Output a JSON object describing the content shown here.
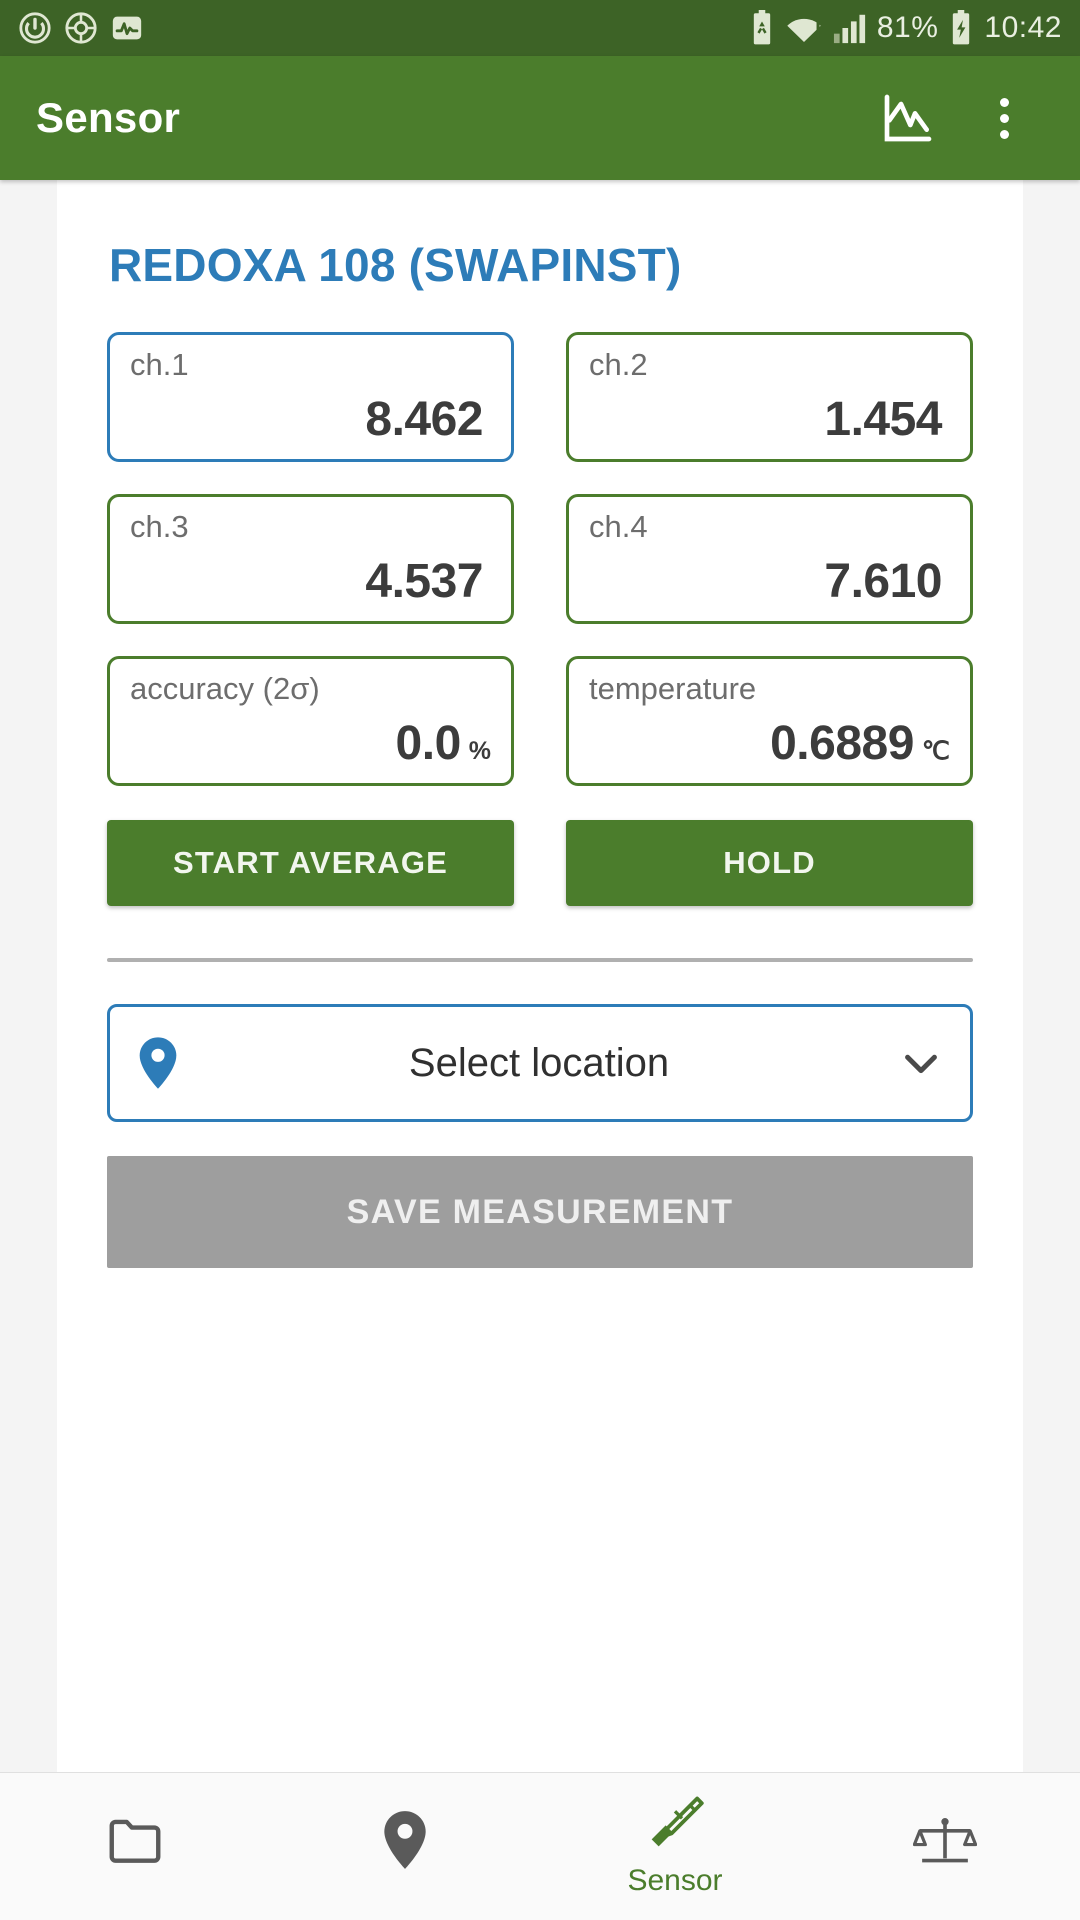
{
  "status_bar": {
    "time": "10:42",
    "battery_percent": "81%",
    "icons_left": [
      "power-circle-icon",
      "radar-target-icon",
      "pulse-chart-icon"
    ],
    "icons_right": [
      "recycle-battery-icon",
      "wifi-warning-icon",
      "cellular-signal-icon",
      "charging-battery-icon"
    ],
    "bg_color": "#3d6326"
  },
  "app_bar": {
    "title": "Sensor",
    "chart_action": "chart-icon",
    "overflow_action": "overflow-menu-icon",
    "bg_color": "#4b7d2c"
  },
  "device": {
    "title": "REDOXA 108 (SWAPINST)",
    "title_color": "#2d7cb8"
  },
  "measurements": [
    {
      "label": "ch.1",
      "value": "8.462",
      "unit": "",
      "accent": "#2d7cb8"
    },
    {
      "label": "ch.2",
      "value": "1.454",
      "unit": "",
      "accent": "#4b7d2c"
    },
    {
      "label": "ch.3",
      "value": "4.537",
      "unit": "",
      "accent": "#4b7d2c"
    },
    {
      "label": "ch.4",
      "value": "7.610",
      "unit": "",
      "accent": "#4b7d2c"
    },
    {
      "label": "accuracy (2σ)",
      "value": "0.0",
      "unit": "%",
      "accent": "#4b7d2c"
    },
    {
      "label": "temperature",
      "value": "0.6889",
      "unit": "℃",
      "accent": "#4b7d2c"
    }
  ],
  "actions": {
    "start_average": "START AVERAGE",
    "hold": "HOLD"
  },
  "location_select": {
    "text": "Select location",
    "pin_icon": "location-pin-icon",
    "chevron_icon": "chevron-down-icon",
    "border_color": "#2d7cb8"
  },
  "save": {
    "label": "SAVE MEASUREMENT",
    "enabled": false,
    "bg_color": "#9e9e9e"
  },
  "bottom_nav": [
    {
      "icon": "folder-icon",
      "label": "",
      "active": false
    },
    {
      "icon": "location-pin-icon",
      "label": "",
      "active": false
    },
    {
      "icon": "sensor-pencil-icon",
      "label": "Sensor",
      "active": true
    },
    {
      "icon": "scales-icon",
      "label": "",
      "active": false
    }
  ]
}
